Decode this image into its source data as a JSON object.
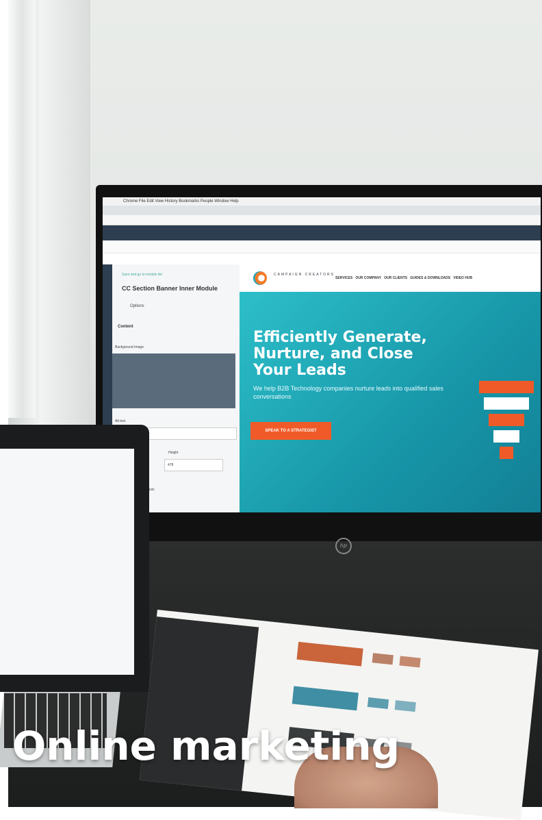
{
  "caption": "Online marketing",
  "screen": {
    "menubar": "Chrome   File   Edit   View   History   Bookmarks   People   Window   Help",
    "editor": {
      "section_label": "Save and go to module list",
      "module_title": "CC Section Banner Inner Module",
      "options_tab": "Options",
      "content_heading": "Content",
      "background_image_label": "Background Image",
      "alt_text_label": "Alt text",
      "height_label": "Height",
      "height_value": "478",
      "tools_label": "Tools"
    },
    "site": {
      "brand": "CAMPAIGN CREATORS",
      "nav": [
        "SERVICES",
        "OUR COMPANY",
        "OUR CLIENTS",
        "GUIDES & DOWNLOADS",
        "VIDEO HUB"
      ],
      "headline": "Efficiently Generate, Nurture, and Close Your Leads",
      "subtext": "We help B2B Technology companies nurture leads into qualified sales conversations",
      "cta": "SPEAK TO A STRATEGIST"
    },
    "monitor_brand": "hp"
  },
  "colors": {
    "hero_teal": "#1fa9b9",
    "cta_orange": "#f05a28",
    "nav_dark": "#2d3e50"
  }
}
